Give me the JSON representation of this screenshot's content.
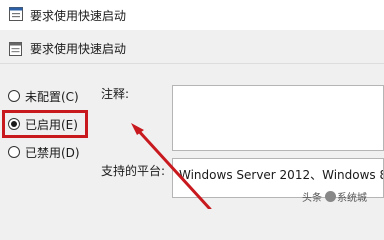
{
  "window": {
    "title": "要求使用快速启动"
  },
  "header": {
    "title": "要求使用快速启动"
  },
  "options": [
    {
      "label": "未配置(C)",
      "selected": false
    },
    {
      "label": "已启用(E)",
      "selected": true
    },
    {
      "label": "已禁用(D)",
      "selected": false
    }
  ],
  "comment": {
    "label": "注释:"
  },
  "platform": {
    "label": "支持的平台:",
    "value": "Windows Server 2012、Windows 8"
  },
  "annotation": {
    "highlight_color": "#c8191e"
  },
  "watermark": {
    "text_prefix": "头条",
    "text_suffix": "系统城"
  }
}
